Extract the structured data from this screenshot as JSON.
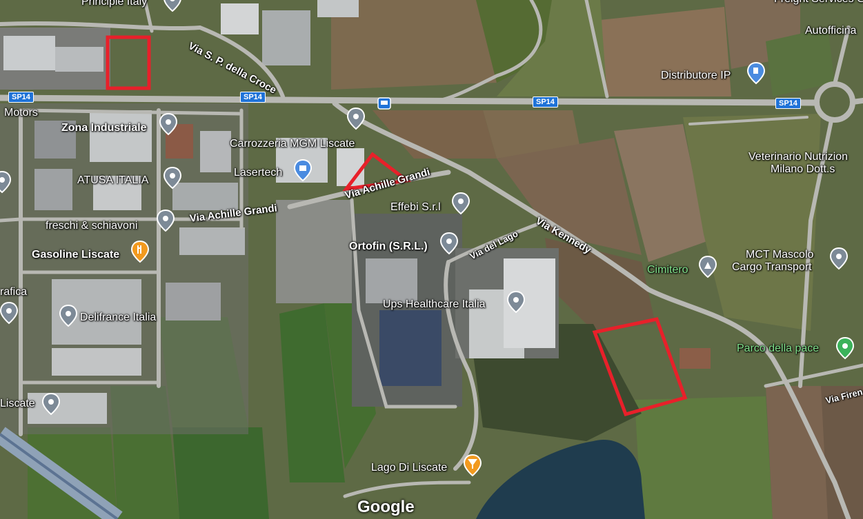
{
  "places": [
    {
      "id": "principle",
      "label": "Principle Italy"
    },
    {
      "id": "motors",
      "label": "Motors"
    },
    {
      "id": "zona",
      "label": "Zona Industriale"
    },
    {
      "id": "carrozzeria",
      "label": "Carrozzeria MGM Liscate"
    },
    {
      "id": "lasertech",
      "label": "Lasertech"
    },
    {
      "id": "atusa",
      "label": "ATUSA ITALIA"
    },
    {
      "id": "effebi",
      "label": "Effebi S.r.l"
    },
    {
      "id": "freschi",
      "label": "freschi & schiavoni"
    },
    {
      "id": "ortofin",
      "label": "Ortofin (S.R.L.)"
    },
    {
      "id": "gasoline",
      "label": "Gasoline Liscate"
    },
    {
      "id": "grafica",
      "label": "rafica"
    },
    {
      "id": "ups",
      "label": "Ups Healthcare Italia"
    },
    {
      "id": "delifrance",
      "label": "Delifrance Italia"
    },
    {
      "id": "liscate",
      "label": "Liscate"
    },
    {
      "id": "lago",
      "label": "Lago Di Liscate"
    },
    {
      "id": "distributore",
      "label": "Distributore IP"
    },
    {
      "id": "autofficina",
      "label": "Autofficina"
    },
    {
      "id": "freight",
      "label": "Freight Services G"
    },
    {
      "id": "veterinario1",
      "label": "Veterinario Nutrizion"
    },
    {
      "id": "veterinario2",
      "label": "Milano Dott.s"
    },
    {
      "id": "mct1",
      "label": "MCT Mascolo"
    },
    {
      "id": "mct2",
      "label": "Cargo Transport"
    },
    {
      "id": "cimitero",
      "label": "Cimitero"
    },
    {
      "id": "parco",
      "label": "Parco della pace"
    }
  ],
  "roads": {
    "croce": "Via S. P. della Croce",
    "grandi1": "Via Achille Grandi",
    "grandi2": "Via Achille Grandi",
    "kennedy": "Via Kennedy",
    "lago": "Via del Lago",
    "firenze": "Via Firen"
  },
  "shields": [
    "SP14",
    "SP14",
    "SP14",
    "SP14"
  ],
  "attribution": "Google",
  "annotation_color": "#e8202a"
}
